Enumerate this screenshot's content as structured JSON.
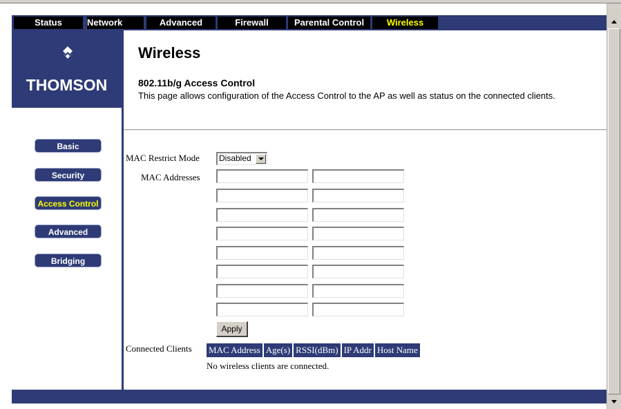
{
  "nav": {
    "tabs": [
      {
        "label": "Status"
      },
      {
        "label": "Network"
      },
      {
        "label": "Advanced"
      },
      {
        "label": "Firewall"
      },
      {
        "label": "Parental Control"
      },
      {
        "label": "Wireless"
      }
    ],
    "active_tab": "Wireless"
  },
  "logo": {
    "brand": "THOMSON"
  },
  "sidebar": {
    "items": [
      {
        "label": "Basic"
      },
      {
        "label": "Security"
      },
      {
        "label": "Access Control"
      },
      {
        "label": "Advanced"
      },
      {
        "label": "Bridging"
      }
    ],
    "active_item": "Access Control"
  },
  "page": {
    "title": "Wireless",
    "subtitle": "802.11b/g Access Control",
    "description": "This page allows configuration of the Access Control to the AP as well as status on the connected clients."
  },
  "form": {
    "mac_restrict_mode_label": "MAC Restrict Mode",
    "mac_restrict_mode_value": "Disabled",
    "mac_addresses_label": "MAC Addresses",
    "mac_addresses": [
      "",
      "",
      "",
      "",
      "",
      "",
      "",
      "",
      "",
      "",
      "",
      "",
      "",
      "",
      "",
      ""
    ],
    "apply_label": "Apply"
  },
  "clients": {
    "label": "Connected Clients",
    "columns": [
      "MAC Address",
      "Age(s)",
      "RSSI(dBm)",
      "IP Addr",
      "Host Name"
    ],
    "empty_message": "No wireless clients are connected."
  },
  "colors": {
    "navy": "#2e3b76",
    "active_text": "#ffff00",
    "tab_background": "#000000"
  }
}
